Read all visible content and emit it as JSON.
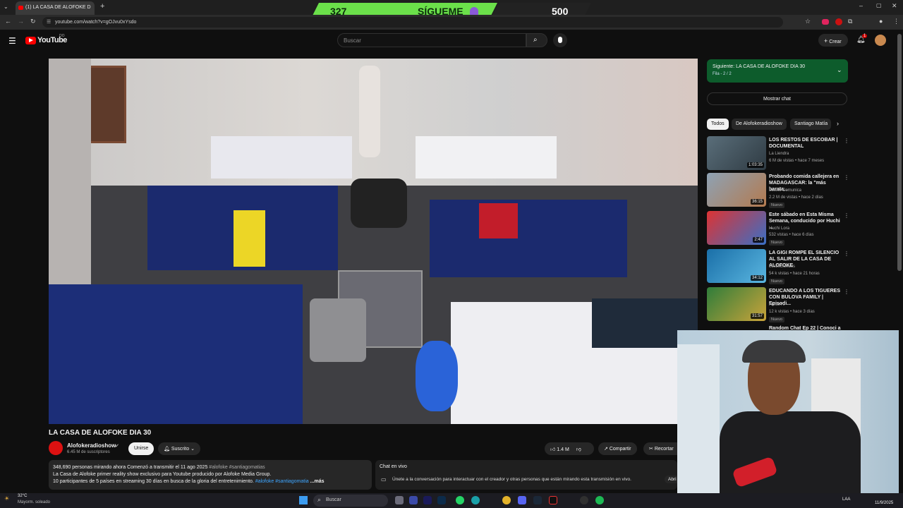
{
  "browser": {
    "tab_title": "(1) LA CASA DE ALOFOKE D",
    "url": "youtube.com/watch?v=gOJvu0xYsdo"
  },
  "overlay": {
    "left_number": "327",
    "center_text": "SÍGUEME",
    "right_number": "500"
  },
  "youtube": {
    "logo_text": "YouTube",
    "logo_sup": "DO",
    "search_placeholder": "Buscar",
    "create_label": "Crear",
    "notification_count": "1"
  },
  "video": {
    "title": "LA CASA DE ALOFOKE DIA 30",
    "channel_name": "Alofokeradioshow",
    "subscribers": "6.45 M de suscriptores",
    "join_label": "Unirse",
    "subscribed_label": "Suscrito",
    "like_count": "1.4 M",
    "share_label": "Compartir",
    "clip_label": "Recortar",
    "description_line1_stats": "348,690 personas mirando ahora  Comenzó a transmitir el 11 ago 2025",
    "description_line1_tags": "#alofoke #santiagomatias",
    "description_line2": "La Casa de Alofoke primer reality show exclusivo para Youtube producido por Alofoke Media Group.",
    "description_line3": "10 participantes de 5 países en streaming 30 días en busca de la gloria del entretenimiento.",
    "description_line3_tags": "#alofoke #santiagomatia",
    "more_label": "...más"
  },
  "chat": {
    "title": "Chat en vivo",
    "prompt": "Únete a la conversación para interactuar con el creador y otras personas que están mirando esta transmisión en vivo.",
    "join_partial": "Abri"
  },
  "sidebar": {
    "next_label": "Siguiente: LA CASA DE ALOFOKE DIA 30",
    "queue_label": "Fila - 2 / 2",
    "show_chat": "Mostrar chat",
    "chips": [
      "Todos",
      "De Alofokeradioshow",
      "Santiago Matía"
    ],
    "recommendations": [
      {
        "title": "LOS RESTOS DE ESCOBAR | DOCUMENTAL",
        "channel": "La Liendra",
        "meta": "6 M de vistas • hace 7 meses",
        "duration": "1:03:35",
        "badge": ""
      },
      {
        "title": "Probando comida callejera en MADAGASCAR: la \"más barata...",
        "channel": "Luisito Comunica",
        "meta": "2.2 M de vistas • hace 2 días",
        "duration": "36:15",
        "badge": "Nuevo"
      },
      {
        "title": "Este sábado en Esta Misma Semana, conducido por Huchi ...",
        "channel": "Huchi Lora",
        "meta": "532 vistas • hace 6 días",
        "duration": "2:47",
        "badge": "Nuevo"
      },
      {
        "title": "LA GIGI ROMPE EL SILENCIO AL SALIR DE LA CASA DE ALOFOKE",
        "channel": "LosJediondos",
        "meta": "54 k vistas • hace 21 horas",
        "duration": "34:12",
        "badge": "Nuevo"
      },
      {
        "title": "EDUCANDO A LOS TIGUERES CON BULOVA FAMILY | Episodi...",
        "channel": "AtecoTV",
        "meta": "12 k vistas • hace 3 días",
        "duration": "31:57",
        "badge": "Nuevo"
      },
      {
        "title": "Random Chat Ep 22 | Conoci a",
        "channel": "",
        "meta": "",
        "duration": "",
        "badge": ""
      }
    ]
  },
  "taskbar": {
    "weather_temp": "32°C",
    "weather_desc": "Mayorm. soleado",
    "search_label": "Buscar",
    "lang": "LAA",
    "date": "11/9/2025"
  },
  "colors": {
    "youtube_red": "#ff0000",
    "banner_green": "#6be04a",
    "next_up_green": "#0d5c2c"
  }
}
